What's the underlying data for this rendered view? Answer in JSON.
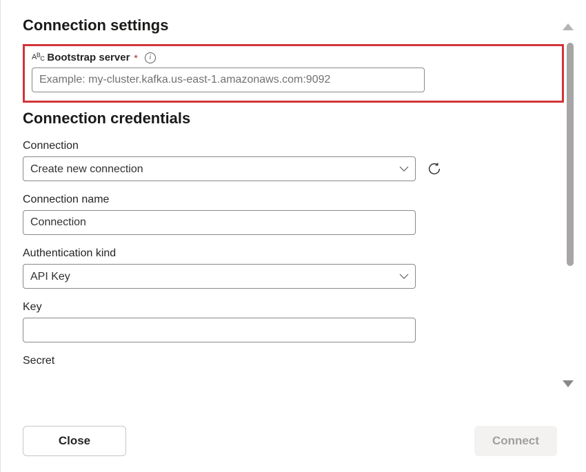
{
  "sections": {
    "settings_header": "Connection settings",
    "credentials_header": "Connection credentials"
  },
  "bootstrap": {
    "label": "Bootstrap server",
    "required_mark": "*",
    "placeholder": "Example: my-cluster.kafka.us-east-1.amazonaws.com:9092",
    "value": ""
  },
  "connection": {
    "label": "Connection",
    "selected": "Create new connection",
    "options": [
      "Create new connection"
    ]
  },
  "connection_name": {
    "label": "Connection name",
    "value": "Connection"
  },
  "auth_kind": {
    "label": "Authentication kind",
    "selected": "API Key",
    "options": [
      "API Key"
    ]
  },
  "key": {
    "label": "Key",
    "value": ""
  },
  "secret": {
    "label": "Secret",
    "value": ""
  },
  "footer": {
    "close_label": "Close",
    "connect_label": "Connect"
  }
}
